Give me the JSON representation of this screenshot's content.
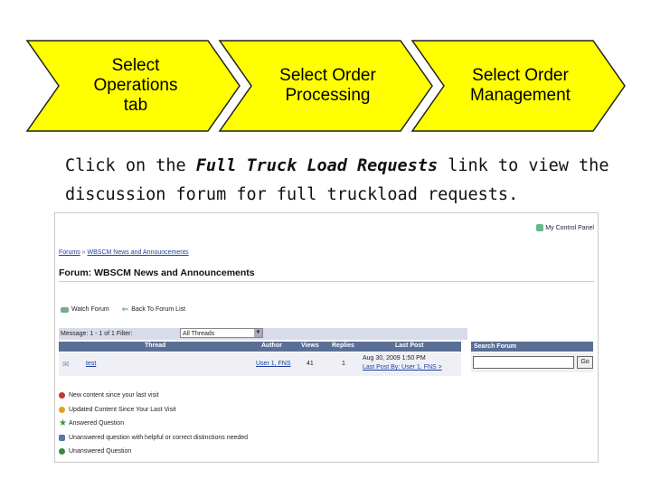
{
  "steps": [
    {
      "label_lines": [
        "Select",
        "Operations",
        "tab"
      ]
    },
    {
      "label_lines": [
        "Select Order",
        "Processing"
      ]
    },
    {
      "label_lines": [
        "Select Order",
        "Management"
      ]
    }
  ],
  "colors": {
    "chevron_fill": "#ffff00",
    "chevron_stroke": "#222222",
    "table_header": "#5a6f96"
  },
  "instruction": {
    "prefix": "Click on the ",
    "link_text": "Full Truck Load Requests",
    "suffix": " link to view the discussion forum for full truckload requests."
  },
  "forum": {
    "my_control_panel": "My Control Panel",
    "breadcrumb": [
      "Forums",
      "WBSCM News and Announcements"
    ],
    "title": "Forum: WBSCM News and Announcements",
    "actions": {
      "watch": "Watch Forum",
      "back": "Back To Forum List"
    },
    "controls": {
      "messages": "Message: 1 - 1 of 1  Filter:",
      "filter_value": "All Threads"
    },
    "columns": [
      "Thread",
      "Author",
      "Views",
      "Replies",
      "Last Post"
    ],
    "row": {
      "thread": "test",
      "author": "User 1, FNS",
      "views": "41",
      "replies": "1",
      "last_post_1": "Aug 30, 2009 1:50 PM",
      "last_post_2": "Last Post By: User 1, FNS >"
    },
    "search": {
      "header": "Search Forum",
      "button": "Go"
    },
    "legend": [
      {
        "text": "New content since your last visit",
        "icon": "new-content-dot",
        "color": "#c0392b"
      },
      {
        "text": "Updated Content Since Your Last Visit",
        "icon": "updated-content-dot",
        "color": "#e6a020"
      },
      {
        "text": "Answered Question",
        "icon": "answered-star-icon",
        "color": "#2e9a3c"
      },
      {
        "text": "Unanswered question with helpful or correct distinctions needed",
        "icon": "unanswered-helpful-icon",
        "color": "#5577aa"
      },
      {
        "text": "Unanswered Question",
        "icon": "unanswered-question-icon",
        "color": "#3a8a3a"
      }
    ]
  }
}
